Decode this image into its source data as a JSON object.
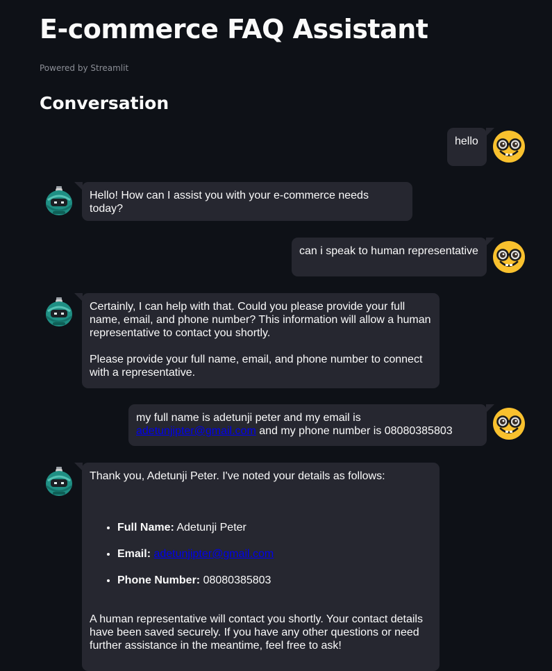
{
  "header": {
    "title": "E-commerce FAQ Assistant",
    "caption": "Powered by Streamlit",
    "section": "Conversation"
  },
  "messages": [
    {
      "role": "user",
      "text": "hello"
    },
    {
      "role": "assistant",
      "text": "Hello! How can I assist you with your e-commerce needs today?"
    },
    {
      "role": "user",
      "text": "can i speak to human representative"
    },
    {
      "role": "assistant",
      "p1": "Certainly, I can help with that. Could you please provide your full name, email, and phone number? This information will allow a human representative to contact you shortly.",
      "p2": "Please provide your full name, email, and phone number to connect with a representative."
    },
    {
      "role": "user",
      "pre": "my full name is adetunji peter and my email is",
      "email": "adetunjipter@gmail.com",
      "post": " and my phone number is 08080385803"
    },
    {
      "role": "assistant",
      "intro": "Thank you, Adetunji Peter. I've noted your details as follows:",
      "name_label": "Full Name:",
      "name_value": " Adetunji Peter",
      "email_label": "Email:",
      "email_value": "adetunjipter@gmail.com",
      "phone_label": "Phone Number:",
      "phone_value": " 08080385803",
      "outro": "A human representative will contact you shortly. Your contact details have been saved securely. If you have any other questions or need further assistance in the meantime, feel free to ask!"
    }
  ],
  "icons": {
    "user_avatar": "nerd-face-icon",
    "assistant_avatar": "robot-icon"
  },
  "colors": {
    "background": "#0e1117",
    "bubble": "#262730",
    "link": "#0000ee",
    "user_avatar": "#f9c12e",
    "robot": "#1f8f84"
  }
}
